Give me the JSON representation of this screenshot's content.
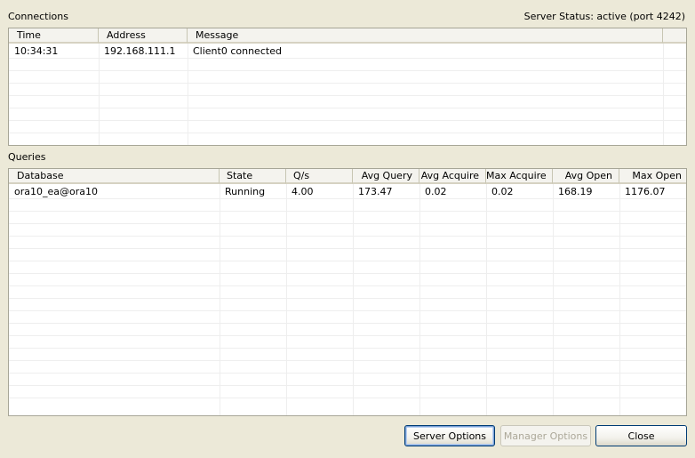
{
  "connections": {
    "label": "Connections",
    "server_status": "Server Status: active (port 4242)",
    "columns": [
      "Time",
      "Address",
      "Message"
    ],
    "rows": [
      [
        "10:34:31",
        "192.168.111.1",
        "Client0 connected"
      ]
    ]
  },
  "queries": {
    "label": "Queries",
    "columns": [
      "Database",
      "State",
      "Q/s",
      "Avg Query",
      "Avg Acquire",
      "Max Acquire",
      "Avg Open",
      "Max Open"
    ],
    "rows": [
      [
        "ora10_ea@ora10",
        "Running",
        "4.00",
        "173.47",
        "0.02",
        "0.02",
        "168.19",
        "1176.07"
      ]
    ]
  },
  "buttons": {
    "server_options": "Server Options",
    "manager_options": "Manager Options",
    "close": "Close"
  }
}
